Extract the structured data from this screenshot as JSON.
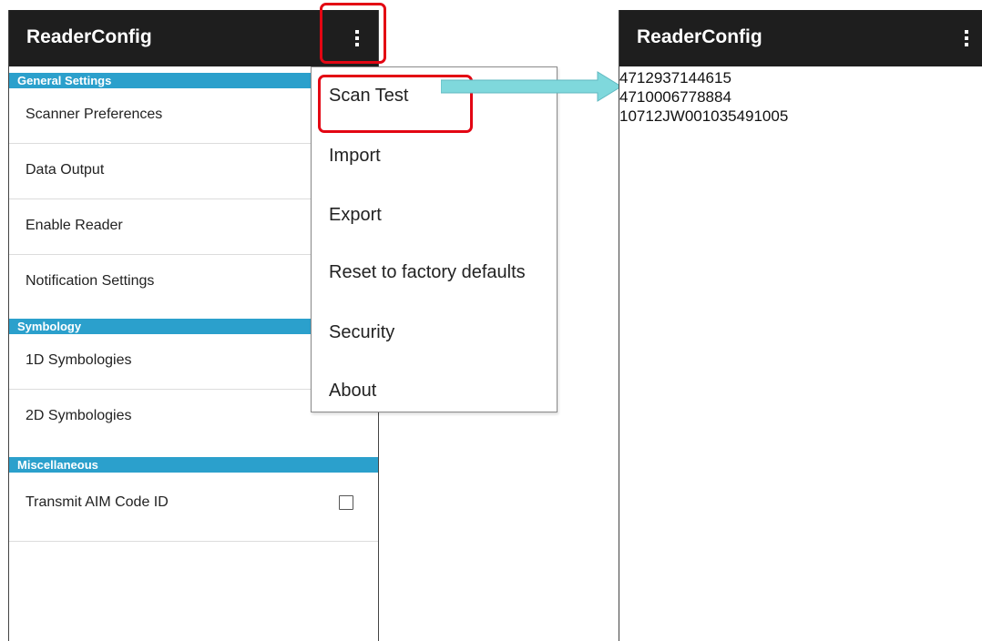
{
  "left_screen": {
    "app_title": "ReaderConfig",
    "sections": [
      {
        "header": "General Settings",
        "items": [
          "Scanner Preferences",
          "Data Output",
          "Enable Reader",
          "Notification Settings"
        ]
      },
      {
        "header": "Symbology",
        "items": [
          "1D Symbologies",
          "2D Symbologies"
        ]
      },
      {
        "header": "Miscellaneous",
        "items": [
          "Transmit AIM Code ID"
        ]
      }
    ],
    "transmit_aim_checked": false
  },
  "overflow_menu": {
    "items": [
      "Scan Test",
      "Import",
      "Export",
      "Reset to factory defaults",
      "Security",
      "About"
    ]
  },
  "right_screen": {
    "app_title": "ReaderConfig",
    "scan_results": [
      "4712937144615",
      "4710006778884",
      "10712JW001035491005"
    ]
  },
  "colors": {
    "appbar": "#1e1e1e",
    "section_header": "#2ba0cc",
    "highlight": "#e30613",
    "arrow": "#7fd8dc"
  },
  "icons": {
    "overflow": "more-vertical-icon",
    "arrow": "right-arrow-icon"
  }
}
